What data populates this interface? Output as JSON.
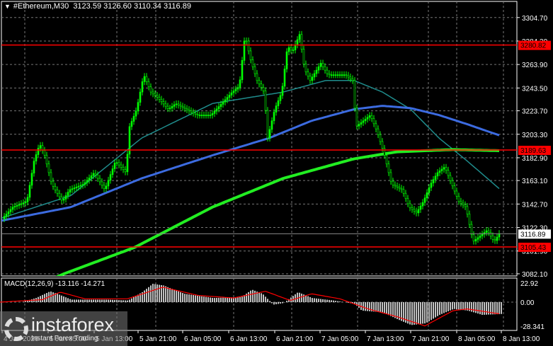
{
  "header": {
    "symbol": "#Ethereum,M30",
    "open": "3123.59",
    "high": "3126.60",
    "low": "3110.34",
    "close": "3116.89"
  },
  "price_axis": {
    "ticks": [
      "3304.70",
      "3284.30",
      "3263.90",
      "3243.50",
      "3223.70",
      "3203.30",
      "3182.90",
      "3163.10",
      "3142.70",
      "3122.30",
      "3101.90",
      "3082.10"
    ],
    "current": "3116.89"
  },
  "levels": [
    {
      "value": 3280.82,
      "label": "3280.82"
    },
    {
      "value": 3189.63,
      "label": "3189.63"
    },
    {
      "value": 3105.43,
      "label": "3105.43"
    }
  ],
  "time_axis": [
    "4 Jan 2026",
    "5 Jan 05:00",
    "5 Jan 13:00",
    "5 Jan 21:00",
    "6 Jan 05:00",
    "6 Jan 13:00",
    "6 Jan 21:00",
    "7 Jan 05:00",
    "7 Jan 13:00",
    "7 Jan 21:00",
    "8 Jan 05:00",
    "8 Jan 13:00"
  ],
  "macd": {
    "label": "MACD(12,26,9) -13.116 -14.271",
    "axis": [
      "22.92",
      "0.00",
      "-28.341"
    ],
    "hist": [
      [
        0,
        0
      ],
      [
        30,
        0
      ],
      [
        50,
        5
      ],
      [
        70,
        13
      ],
      [
        80,
        10
      ],
      [
        100,
        3
      ],
      [
        150,
        3
      ],
      [
        180,
        2
      ],
      [
        200,
        12
      ],
      [
        215,
        22
      ],
      [
        230,
        20
      ],
      [
        260,
        10
      ],
      [
        300,
        5
      ],
      [
        340,
        6
      ],
      [
        355,
        15
      ],
      [
        370,
        10
      ],
      [
        385,
        -3
      ],
      [
        400,
        -1
      ],
      [
        420,
        12
      ],
      [
        440,
        5
      ],
      [
        470,
        2
      ],
      [
        500,
        -2
      ],
      [
        510,
        -10
      ],
      [
        540,
        -12
      ],
      [
        560,
        -20
      ],
      [
        580,
        -27
      ],
      [
        600,
        -25
      ],
      [
        620,
        -15
      ],
      [
        640,
        -8
      ],
      [
        660,
        -10
      ],
      [
        680,
        -15
      ],
      [
        707,
        -14
      ]
    ],
    "signal": [
      [
        0,
        0
      ],
      [
        60,
        3
      ],
      [
        85,
        12
      ],
      [
        120,
        4
      ],
      [
        180,
        4
      ],
      [
        230,
        18
      ],
      [
        280,
        8
      ],
      [
        330,
        5
      ],
      [
        375,
        13
      ],
      [
        410,
        2
      ],
      [
        440,
        10
      ],
      [
        480,
        4
      ],
      [
        520,
        -8
      ],
      [
        560,
        -17
      ],
      [
        600,
        -28
      ],
      [
        640,
        -10
      ],
      [
        660,
        -8
      ],
      [
        707,
        -14
      ]
    ]
  },
  "price_path": [
    [
      5,
      3130
    ],
    [
      20,
      3140
    ],
    [
      40,
      3145
    ],
    [
      50,
      3180
    ],
    [
      58,
      3195
    ],
    [
      65,
      3185
    ],
    [
      75,
      3160
    ],
    [
      90,
      3145
    ],
    [
      100,
      3155
    ],
    [
      120,
      3160
    ],
    [
      135,
      3170
    ],
    [
      150,
      3155
    ],
    [
      165,
      3180
    ],
    [
      180,
      3170
    ],
    [
      185,
      3210
    ],
    [
      195,
      3225
    ],
    [
      205,
      3255
    ],
    [
      215,
      3240
    ],
    [
      225,
      3235
    ],
    [
      240,
      3225
    ],
    [
      250,
      3230
    ],
    [
      265,
      3225
    ],
    [
      280,
      3220
    ],
    [
      300,
      3220
    ],
    [
      315,
      3230
    ],
    [
      330,
      3240
    ],
    [
      340,
      3245
    ],
    [
      348,
      3290
    ],
    [
      355,
      3270
    ],
    [
      365,
      3250
    ],
    [
      375,
      3240
    ],
    [
      380,
      3200
    ],
    [
      390,
      3225
    ],
    [
      400,
      3240
    ],
    [
      408,
      3280
    ],
    [
      415,
      3275
    ],
    [
      425,
      3290
    ],
    [
      432,
      3260
    ],
    [
      440,
      3250
    ],
    [
      455,
      3265
    ],
    [
      465,
      3255
    ],
    [
      480,
      3255
    ],
    [
      490,
      3255
    ],
    [
      500,
      3250
    ],
    [
      505,
      3210
    ],
    [
      515,
      3215
    ],
    [
      525,
      3220
    ],
    [
      535,
      3205
    ],
    [
      545,
      3185
    ],
    [
      555,
      3160
    ],
    [
      570,
      3155
    ],
    [
      580,
      3140
    ],
    [
      590,
      3135
    ],
    [
      600,
      3145
    ],
    [
      610,
      3160
    ],
    [
      620,
      3170
    ],
    [
      630,
      3175
    ],
    [
      640,
      3160
    ],
    [
      650,
      3145
    ],
    [
      660,
      3140
    ],
    [
      670,
      3110
    ],
    [
      680,
      3115
    ],
    [
      690,
      3120
    ],
    [
      700,
      3110
    ],
    [
      707,
      3117
    ]
  ],
  "ma_teal": [
    [
      0,
      3130
    ],
    [
      100,
      3150
    ],
    [
      200,
      3200
    ],
    [
      300,
      3230
    ],
    [
      400,
      3240
    ],
    [
      460,
      3250
    ],
    [
      500,
      3250
    ],
    [
      540,
      3240
    ],
    [
      580,
      3225
    ],
    [
      620,
      3200
    ],
    [
      660,
      3180
    ],
    [
      707,
      3155
    ]
  ],
  "ma_blue": [
    [
      0,
      3128
    ],
    [
      100,
      3140
    ],
    [
      200,
      3165
    ],
    [
      300,
      3185
    ],
    [
      380,
      3200
    ],
    [
      440,
      3215
    ],
    [
      500,
      3225
    ],
    [
      540,
      3228
    ],
    [
      580,
      3226
    ],
    [
      620,
      3220
    ],
    [
      660,
      3212
    ],
    [
      707,
      3202
    ]
  ],
  "ma_green": [
    [
      60,
      3074
    ],
    [
      90,
      3082
    ],
    [
      190,
      3105
    ],
    [
      300,
      3140
    ],
    [
      400,
      3165
    ],
    [
      500,
      3182
    ],
    [
      560,
      3188
    ],
    [
      640,
      3190
    ],
    [
      707,
      3189
    ]
  ],
  "colors": {
    "candle": "#00ff00",
    "level": "#ff0000",
    "teal": "#1f8c8c",
    "blue": "#3c6be0",
    "green": "#22ee22"
  },
  "logo": {
    "name": "instaforex",
    "tagline": "Instant Forex Trading"
  }
}
